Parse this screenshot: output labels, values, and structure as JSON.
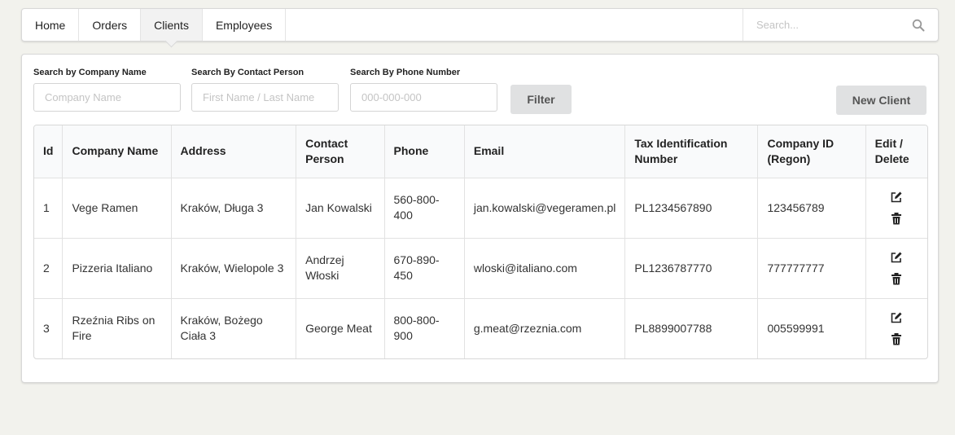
{
  "menu": {
    "items": [
      {
        "label": "Home"
      },
      {
        "label": "Orders"
      },
      {
        "label": "Clients"
      },
      {
        "label": "Employees"
      }
    ],
    "active": "Clients",
    "search_placeholder": "Search..."
  },
  "filters": {
    "company": {
      "label": "Search by Company Name",
      "placeholder": "Company Name"
    },
    "contact": {
      "label": "Search By Contact Person",
      "placeholder": "First Name / Last Name"
    },
    "phone": {
      "label": "Search By Phone Number",
      "placeholder": "000-000-000"
    },
    "filter_button": "Filter",
    "new_client_button": "New Client"
  },
  "table": {
    "headers": [
      "Id",
      "Company Name",
      "Address",
      "Contact Person",
      "Phone",
      "Email",
      "Tax Identification Number",
      "Company ID (Regon)",
      "Edit / Delete"
    ],
    "rows": [
      {
        "id": "1",
        "company": "Vege Ramen",
        "address": "Kraków, Długa 3",
        "contact": "Jan Kowalski",
        "phone": "560-800-400",
        "email": "jan.kowalski@vegeramen.pl",
        "nip": "PL1234567890",
        "regon": "123456789"
      },
      {
        "id": "2",
        "company": "Pizzeria Italiano",
        "address": "Kraków, Wielopole 3",
        "contact": "Andrzej Włoski",
        "phone": "670-890-450",
        "email": "wloski@italiano.com",
        "nip": "PL1236787770",
        "regon": "777777777"
      },
      {
        "id": "3",
        "company": "Rzeźnia Ribs on Fire",
        "address": "Kraków, Bożego Ciała 3",
        "contact": "George Meat",
        "phone": "800-800-900",
        "email": "g.meat@rzeznia.com",
        "nip": "PL8899007788",
        "regon": "005599991"
      }
    ]
  },
  "icons": {
    "search": "search-icon",
    "edit": "edit-icon",
    "delete": "trash-icon"
  }
}
